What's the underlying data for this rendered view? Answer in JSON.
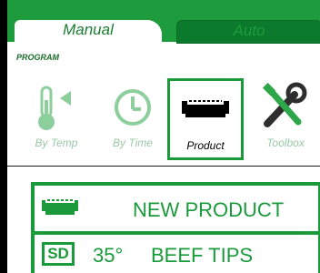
{
  "tabs": [
    {
      "label": "Manual",
      "active": true
    },
    {
      "label": "Auto",
      "active": false
    }
  ],
  "section": {
    "label": "PROGRAM"
  },
  "program_options": [
    {
      "label": "By Temp",
      "icon": "thermometer-icon",
      "selected": false
    },
    {
      "label": "By Time",
      "icon": "clock-icon",
      "selected": false
    },
    {
      "label": "Product",
      "icon": "pan-icon",
      "selected": true
    },
    {
      "label": "Toolbox",
      "icon": "tools-icon",
      "selected": false
    }
  ],
  "products": [
    {
      "label": "NEW PRODUCT",
      "icon": "pan-icon"
    },
    {
      "badge": "SD",
      "temp": "35°",
      "label": "BEEF TIPS"
    }
  ],
  "colors": {
    "accent": "#1a9a3b",
    "tab_bar": "#1e9b3c",
    "dim": "#9ac8a6"
  }
}
